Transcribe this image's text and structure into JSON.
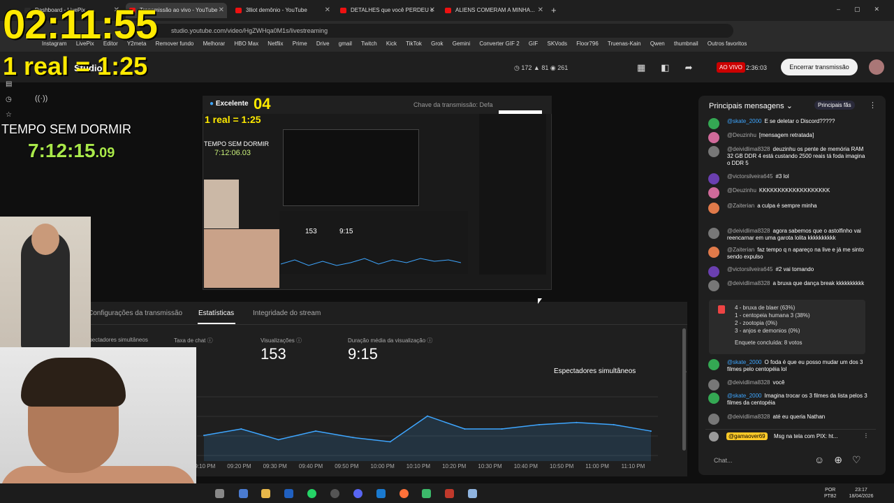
{
  "browser": {
    "tabs": [
      {
        "label": "Dashboard - LivePix",
        "active": false
      },
      {
        "label": "Transmissão ao vivo - YouTube",
        "active": true
      },
      {
        "label": "3lliot demônio - YouTube",
        "active": false
      },
      {
        "label": "DETALHES que você PERDEU e",
        "active": false
      },
      {
        "label": "ALIENS COMERAM A MINHA...",
        "active": false
      }
    ],
    "url": "studio.youtube.com/video/HgZWHqa0M1s/livestreaming",
    "bookmarks": [
      "Instagram",
      "LivePix",
      "Editor",
      "Y2meta",
      "Remover fundo",
      "Melhorar",
      "HBO Max",
      "Netflix",
      "Prime",
      "Drive",
      "gmail",
      "Twitch",
      "Kick",
      "TikTok",
      "Grok",
      "Gemini",
      "Converter GIF 2",
      "GIF",
      "SKVods",
      "Floor796",
      "Truenas-Kain",
      "Qwen",
      "thumbnail",
      "Outros favoritos"
    ]
  },
  "overlay": {
    "clock": "02:11:55",
    "rate": "1 real = 1:25",
    "no_sleep_label": "TEMPO SEM DORMIR",
    "no_sleep_value": "7:12:15",
    "no_sleep_fraction": ".09"
  },
  "studio": {
    "brand": "Studio",
    "counts": {
      "a": "172",
      "b": "81",
      "c": "261"
    },
    "live_badge": "AO VIVO",
    "live_time": "2:36:03",
    "end_button": "Encerrar transmissão"
  },
  "preview": {
    "quality": "Excelente",
    "overlay_num": "04",
    "mini_rate": "1 real = 1:25",
    "stream_key": "Chave da transmissão: Defa",
    "mini_label": "TEMPO SEM DORMIR",
    "mini_value": "7:12:06.03",
    "mini_stats": [
      "153",
      "9:15"
    ]
  },
  "stats": {
    "tabs": [
      "Configurações da transmissão",
      "Estatísticas",
      "Integridade do stream"
    ],
    "labels": {
      "concurrent": "Espectadores simultâneos",
      "chat_rate": "Taxa de chat",
      "views": "Visualizações",
      "avg_duration": "Duração média da visualização"
    },
    "values": {
      "views": "153",
      "avg_duration": "9:15"
    },
    "metric_dropdown": "Espectadores simultâneos"
  },
  "chart_data": {
    "type": "line",
    "x": [
      "09:10 PM",
      "09:20 PM",
      "09:30 PM",
      "09:40 PM",
      "09:50 PM",
      "10:00 PM",
      "10:10 PM",
      "10:20 PM",
      "10:30 PM",
      "10:40 PM",
      "10:50 PM",
      "11:00 PM",
      "11:10 PM"
    ],
    "xlabel": "",
    "ylabel": "",
    "series": [
      {
        "values": [
          12,
          15,
          10,
          14,
          11,
          9,
          21,
          15,
          15,
          17,
          18,
          17,
          14
        ]
      }
    ],
    "ylim": [
      0,
      30
    ],
    "grid": true,
    "color": "#3ea6ff"
  },
  "chat": {
    "header": "Principais mensagens",
    "fans_button": "Principais fãs",
    "messages": [
      {
        "name": "@skate_2000",
        "text": "E se deletar o Discord?????",
        "blue": true,
        "color": "#34a853"
      },
      {
        "name": "@Deuzinhu",
        "text": "[mensagem retratada]",
        "blue": false,
        "color": "#d06a9a"
      },
      {
        "name": "@deividlima8328",
        "text": "deuzinhu os pente de memória RAM 32 GB DDR 4 está custando 2500 reais tá foda imagina o DDR 5",
        "blue": false,
        "color": "#777"
      },
      {
        "name": "@victorsilveira645",
        "text": "#3 lol",
        "blue": false,
        "color": "#6a3fb0"
      },
      {
        "name": "@Deuzinhu",
        "text": "KKKKKKKKKKKKKKKKKKK",
        "blue": false,
        "color": "#d06a9a"
      },
      {
        "name": "@Zaiterian",
        "text": "a culpa é sempre minha",
        "blue": false,
        "color": "#e07a4a"
      },
      {
        "name": "@deividlima8328",
        "text": "agora sabemos que o astolfinho vai reencarnar em uma garota lolita kkkkkkkkkk",
        "blue": false,
        "color": "#777"
      },
      {
        "name": "@Zaiterian",
        "text": "faz tempo q n apareço na live e já me sinto sendo expulso",
        "blue": false,
        "color": "#e07a4a"
      },
      {
        "name": "@victorsilveira645",
        "text": "#2 vai tomando",
        "blue": false,
        "color": "#6a3fb0"
      },
      {
        "name": "@deividlima8328",
        "text": "a bruxa que dança break kkkkkkkkkk",
        "blue": false,
        "color": "#777"
      },
      {
        "name": "@skate_2000",
        "text": "O foda é que eu posso mudar um dos 3 filmes pelo centopéia lol",
        "blue": true,
        "color": "#34a853"
      },
      {
        "name": "@deividlima8328",
        "text": "você",
        "blue": false,
        "color": "#777"
      },
      {
        "name": "@skate_2000",
        "text": "Imagina trocar os 3 filmes da lista pelos 3 filmes da centopéia",
        "blue": true,
        "color": "#34a853"
      },
      {
        "name": "@deividlima8328",
        "text": "até eu queria Nathan",
        "blue": false,
        "color": "#777"
      }
    ],
    "poll": [
      "4 - bruxa de blaer (63%)",
      "1 - centopeia humana 3 (38%)",
      "2 - zootopia (0%)",
      "3 - anjos e demonios (0%)"
    ],
    "poll_footer": "Enquete concluída: 8 votos",
    "pinned_name": "@gamaover69",
    "pinned_text": "Msg na tela com PIX: ht...",
    "input_placeholder": "Chat..."
  },
  "taskbar": {
    "lang": "POR",
    "lang2": "PTB2",
    "time": "23:17",
    "date": "18/04/2026"
  }
}
